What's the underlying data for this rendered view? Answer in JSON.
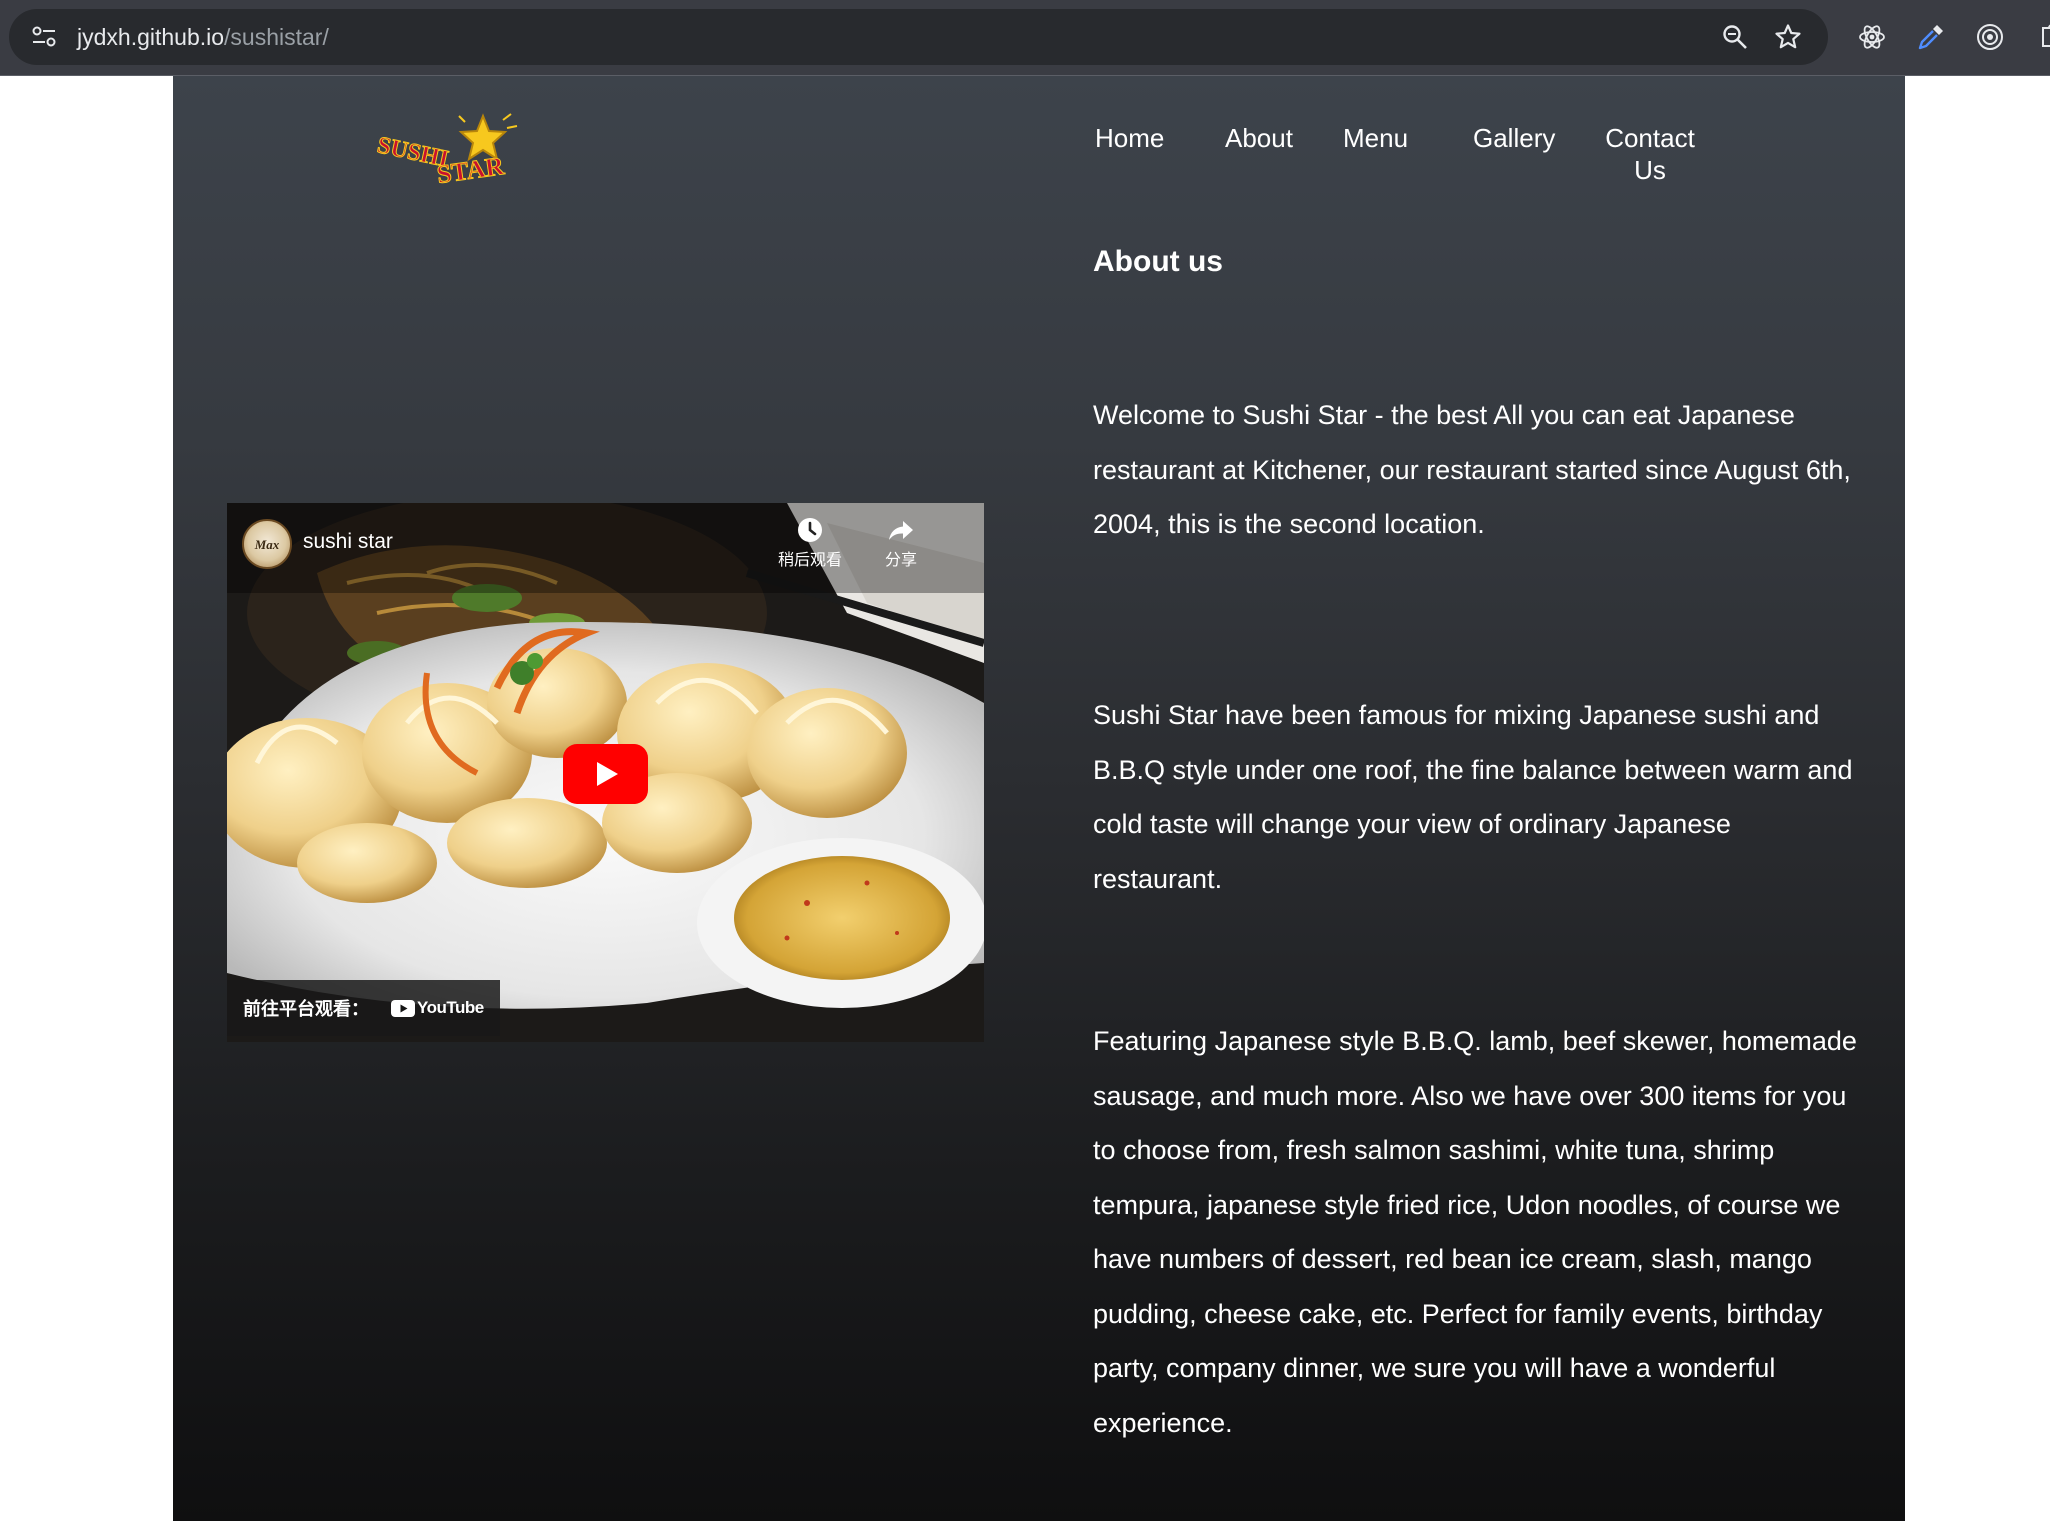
{
  "browser": {
    "url_host": "jydxh.github.io",
    "url_path": "/sushistar/",
    "icons": [
      "site-info-icon",
      "zoom-icon",
      "bookmark-star-icon",
      "react-devtools-icon",
      "eyedropper-icon",
      "target-extension-icon",
      "extensions-puzzle-icon"
    ]
  },
  "logo": {
    "word1": "SUSHI",
    "word2": "STAR"
  },
  "nav": {
    "home": "Home",
    "about": "About",
    "menu": "Menu",
    "gallery": "Gallery",
    "contact": "Contact Us"
  },
  "about": {
    "title": "About us",
    "paragraphs": [
      "Welcome to Sushi Star - the best All you can eat Japanese restaurant at Kitchener, our restaurant started since August 6th, 2004, this is the second location.",
      "Sushi Star have been famous for mixing Japanese sushi and B.B.Q style under one roof, the fine balance between warm and cold taste will change your view of ordinary Japanese restaurant.",
      "Featuring Japanese style B.B.Q. lamb, beef skewer, homemade sausage, and much more. Also we have over 300 items for you to choose from, fresh salmon sashimi, white tuna, shrimp tempura, japanese style fried rice, Udon noodles, of course we have numbers of dessert, red bean ice cream, slash, mango pudding, cheese cake, etc. Perfect for family events, birthday party, company dinner, we sure you will have a wonderful experience."
    ]
  },
  "video": {
    "channel_avatar_text": "Max",
    "title": "sushi star",
    "watch_later": "稍后观看",
    "share": "分享",
    "watch_on": "前往平台观看：",
    "platform": "YouTube"
  },
  "colors": {
    "page_top": "#3d434b",
    "page_bottom": "#0f0f10",
    "youtube_red": "#ff0000",
    "logo_red": "#c8102e",
    "logo_gold": "#f7c81e"
  }
}
